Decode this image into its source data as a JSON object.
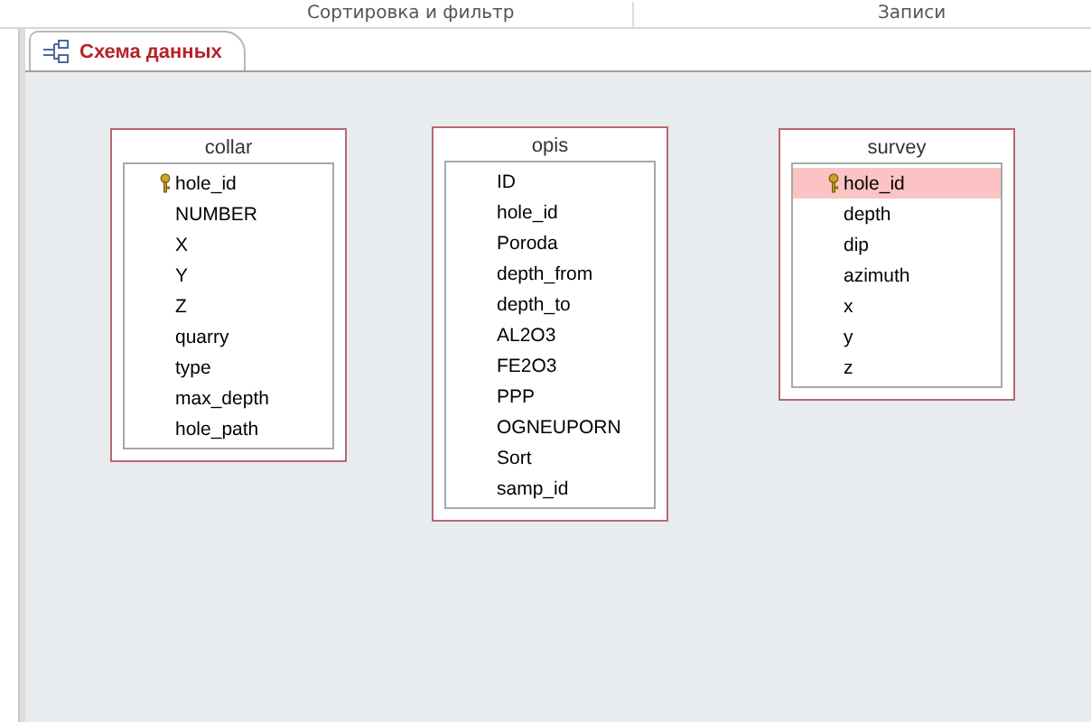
{
  "ribbon": {
    "groups": [
      "Сортировка и фильтр",
      "Записи"
    ]
  },
  "tab": {
    "label": "Схема данных",
    "selected": true
  },
  "tables": [
    {
      "title": "collar",
      "fields": [
        {
          "name": "hole_id",
          "key": true,
          "selected": false
        },
        {
          "name": "NUMBER",
          "key": false,
          "selected": false
        },
        {
          "name": "X",
          "key": false,
          "selected": false
        },
        {
          "name": "Y",
          "key": false,
          "selected": false
        },
        {
          "name": "Z",
          "key": false,
          "selected": false
        },
        {
          "name": "quarry",
          "key": false,
          "selected": false
        },
        {
          "name": "type",
          "key": false,
          "selected": false
        },
        {
          "name": "max_depth",
          "key": false,
          "selected": false
        },
        {
          "name": "hole_path",
          "key": false,
          "selected": false
        }
      ]
    },
    {
      "title": "opis",
      "fields": [
        {
          "name": "ID",
          "key": false,
          "selected": false
        },
        {
          "name": "hole_id",
          "key": false,
          "selected": false
        },
        {
          "name": "Poroda",
          "key": false,
          "selected": false
        },
        {
          "name": "depth_from",
          "key": false,
          "selected": false
        },
        {
          "name": "depth_to",
          "key": false,
          "selected": false
        },
        {
          "name": "AL2O3",
          "key": false,
          "selected": false
        },
        {
          "name": "FE2O3",
          "key": false,
          "selected": false
        },
        {
          "name": "PPP",
          "key": false,
          "selected": false
        },
        {
          "name": "OGNEUPORN",
          "key": false,
          "selected": false
        },
        {
          "name": "Sort",
          "key": false,
          "selected": false
        },
        {
          "name": "samp_id",
          "key": false,
          "selected": false
        }
      ]
    },
    {
      "title": "survey",
      "fields": [
        {
          "name": "hole_id",
          "key": true,
          "selected": true
        },
        {
          "name": "depth",
          "key": false,
          "selected": false
        },
        {
          "name": "dip",
          "key": false,
          "selected": false
        },
        {
          "name": "azimuth",
          "key": false,
          "selected": false
        },
        {
          "name": "x",
          "key": false,
          "selected": false
        },
        {
          "name": "y",
          "key": false,
          "selected": false
        },
        {
          "name": "z",
          "key": false,
          "selected": false
        }
      ]
    }
  ]
}
